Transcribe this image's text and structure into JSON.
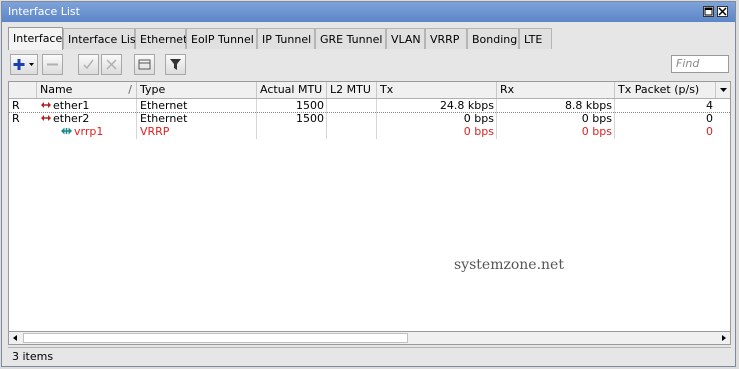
{
  "window": {
    "title": "Interface List"
  },
  "tabs": [
    {
      "label": "Interface",
      "active": true
    },
    {
      "label": "Interface List"
    },
    {
      "label": "Ethernet"
    },
    {
      "label": "EoIP Tunnel"
    },
    {
      "label": "IP Tunnel"
    },
    {
      "label": "GRE Tunnel"
    },
    {
      "label": "VLAN"
    },
    {
      "label": "VRRP"
    },
    {
      "label": "Bonding"
    },
    {
      "label": "LTE"
    }
  ],
  "toolbar": {
    "add_icon": "plus-icon",
    "remove_icon": "minus-icon",
    "enable_icon": "check-icon",
    "disable_icon": "x-icon",
    "comment_icon": "comment-icon",
    "filter_icon": "filter-icon",
    "find_placeholder": "Find"
  },
  "table": {
    "columns": [
      "Name",
      "Type",
      "Actual MTU",
      "L2 MTU",
      "Tx",
      "Rx",
      "Tx Packet (p/s)"
    ],
    "sort_indicator": "/",
    "rows": [
      {
        "flag": "R",
        "name": "ether1",
        "type": "Ethernet",
        "actual_mtu": "1500",
        "l2_mtu": "",
        "tx": "24.8 kbps",
        "rx": "8.8 kbps",
        "tx_packet": "4",
        "color": "#000000"
      },
      {
        "flag": "R",
        "name": "ether2",
        "type": "Ethernet",
        "actual_mtu": "1500",
        "l2_mtu": "",
        "tx": "0 bps",
        "rx": "0 bps",
        "tx_packet": "0",
        "color": "#000000"
      },
      {
        "flag": "",
        "name": "vrrp1",
        "type": "VRRP",
        "actual_mtu": "",
        "l2_mtu": "",
        "tx": "0 bps",
        "rx": "0 bps",
        "tx_packet": "0",
        "color": "#e02020"
      }
    ]
  },
  "watermark": "systemzone.net",
  "status": {
    "items_count": "3 items"
  }
}
